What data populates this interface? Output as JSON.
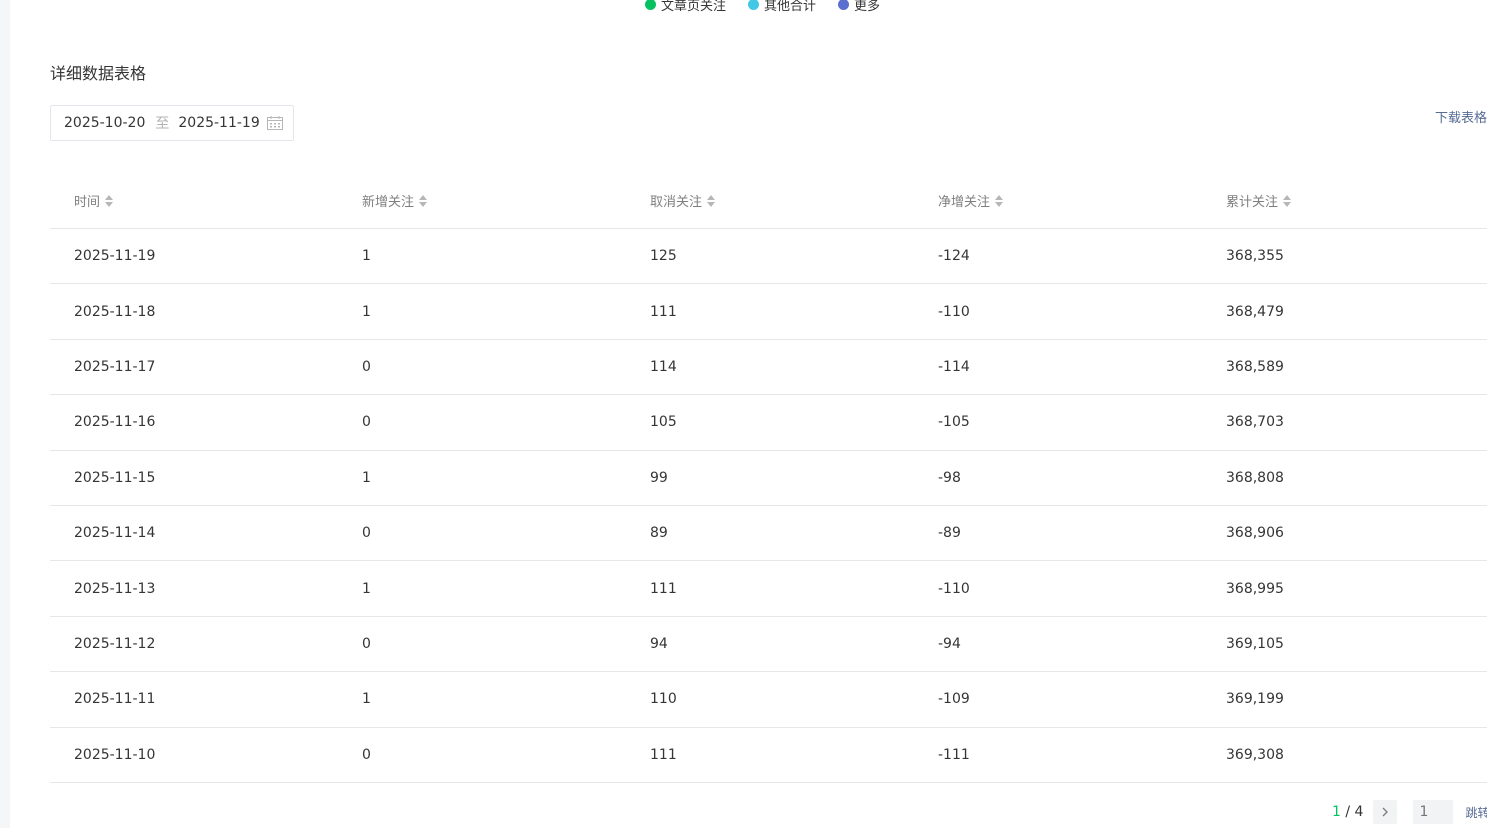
{
  "legend": {
    "items": [
      {
        "label": "文章页关注",
        "color": "#07c160"
      },
      {
        "label": "其他合计",
        "color": "#40c8e6"
      },
      {
        "label": "更多",
        "color": "#5b6fd0"
      }
    ]
  },
  "section_title": "详细数据表格",
  "date_range": {
    "start": "2025-10-20",
    "separator": "至",
    "end": "2025-11-19",
    "icon": "calendar-icon"
  },
  "download_label": "下载表格",
  "table": {
    "headers": [
      "时间",
      "新增关注",
      "取消关注",
      "净增关注",
      "累计关注"
    ],
    "rows": [
      [
        "2025-11-19",
        "1",
        "125",
        "-124",
        "368,355"
      ],
      [
        "2025-11-18",
        "1",
        "111",
        "-110",
        "368,479"
      ],
      [
        "2025-11-17",
        "0",
        "114",
        "-114",
        "368,589"
      ],
      [
        "2025-11-16",
        "0",
        "105",
        "-105",
        "368,703"
      ],
      [
        "2025-11-15",
        "1",
        "99",
        "-98",
        "368,808"
      ],
      [
        "2025-11-14",
        "0",
        "89",
        "-89",
        "368,906"
      ],
      [
        "2025-11-13",
        "1",
        "111",
        "-110",
        "368,995"
      ],
      [
        "2025-11-12",
        "0",
        "94",
        "-94",
        "369,105"
      ],
      [
        "2025-11-11",
        "1",
        "110",
        "-109",
        "369,199"
      ],
      [
        "2025-11-10",
        "0",
        "111",
        "-111",
        "369,308"
      ]
    ]
  },
  "pagination": {
    "current": "1",
    "separator": " / ",
    "total": "4",
    "input_placeholder": "1",
    "jump_label": "跳转"
  }
}
